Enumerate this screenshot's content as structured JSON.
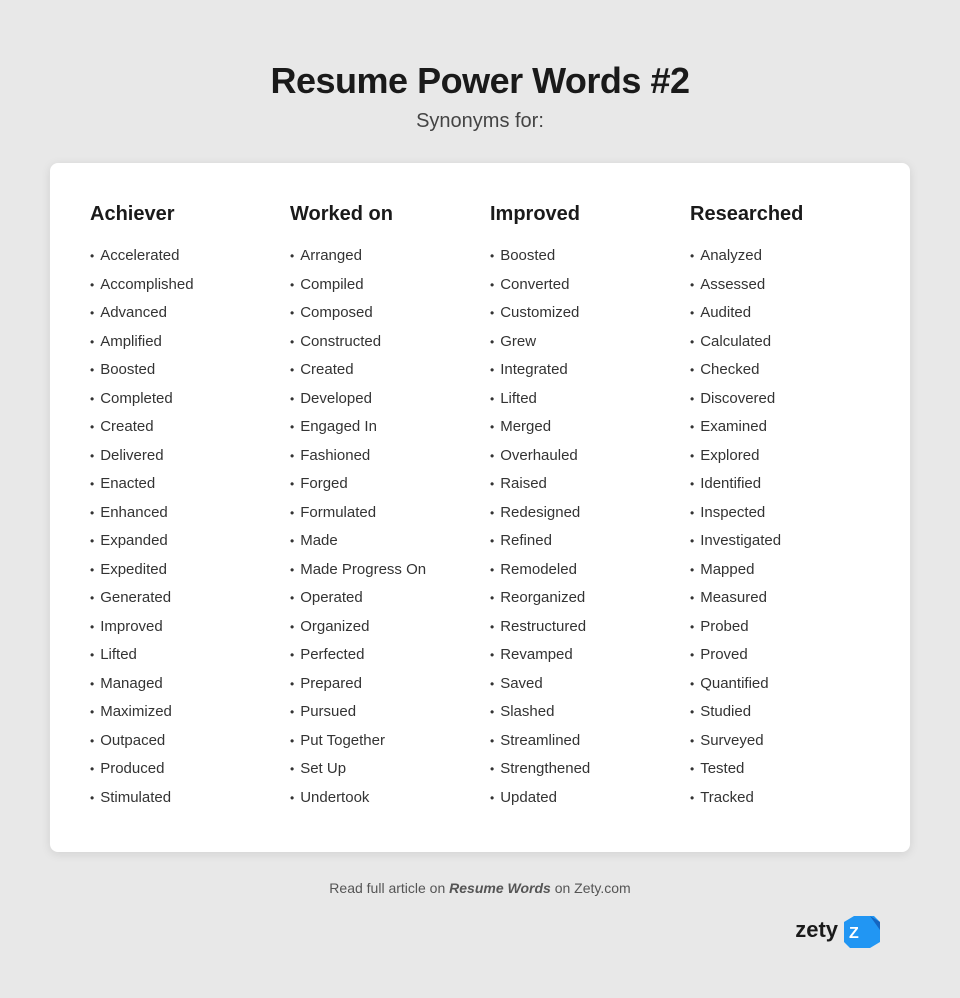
{
  "header": {
    "title": "Resume Power Words #2",
    "subtitle": "Synonyms for:"
  },
  "columns": [
    {
      "header": "Achiever",
      "words": [
        "Accelerated",
        "Accomplished",
        "Advanced",
        "Amplified",
        "Boosted",
        "Completed",
        "Created",
        "Delivered",
        "Enacted",
        "Enhanced",
        "Expanded",
        "Expedited",
        "Generated",
        "Improved",
        "Lifted",
        "Managed",
        "Maximized",
        "Outpaced",
        "Produced",
        "Stimulated"
      ]
    },
    {
      "header": "Worked on",
      "words": [
        "Arranged",
        "Compiled",
        "Composed",
        "Constructed",
        "Created",
        "Developed",
        "Engaged In",
        "Fashioned",
        "Forged",
        "Formulated",
        "Made",
        "Made Progress On",
        "Operated",
        "Organized",
        "Perfected",
        "Prepared",
        "Pursued",
        "Put Together",
        "Set Up",
        "Undertook"
      ]
    },
    {
      "header": "Improved",
      "words": [
        "Boosted",
        "Converted",
        "Customized",
        "Grew",
        "Integrated",
        "Lifted",
        "Merged",
        "Overhauled",
        "Raised",
        "Redesigned",
        "Refined",
        "Remodeled",
        "Reorganized",
        "Restructured",
        "Revamped",
        "Saved",
        "Slashed",
        "Streamlined",
        "Strengthened",
        "Updated"
      ]
    },
    {
      "header": "Researched",
      "words": [
        "Analyzed",
        "Assessed",
        "Audited",
        "Calculated",
        "Checked",
        "Discovered",
        "Examined",
        "Explored",
        "Identified",
        "Inspected",
        "Investigated",
        "Mapped",
        "Measured",
        "Probed",
        "Proved",
        "Quantified",
        "Studied",
        "Surveyed",
        "Tested",
        "Tracked"
      ]
    }
  ],
  "footer": {
    "text_prefix": "Read full article on ",
    "link_text": "Resume Words",
    "text_suffix": " on Zety.com"
  },
  "logo": {
    "text": "zety"
  }
}
